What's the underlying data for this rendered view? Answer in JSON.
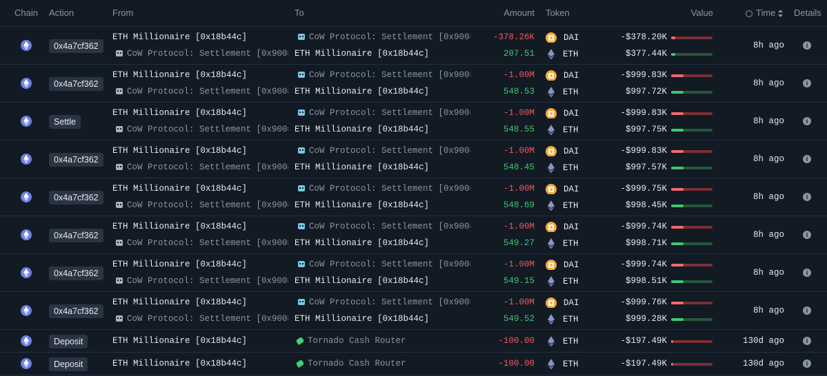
{
  "header": {
    "chain": "Chain",
    "action": "Action",
    "from": "From",
    "to": "To",
    "amount": "Amount",
    "token": "Token",
    "value": "Value",
    "time": "Time",
    "details": "Details"
  },
  "colors": {
    "negative": "#ef5a5a",
    "positive": "#3fc66f",
    "dai": "#f5ac37",
    "eth_chain": "#6f7fe6"
  },
  "rows": [
    {
      "action": "0x4a7cf362",
      "time": "8h ago",
      "from1": "ETH Millionaire [0x18b44c]",
      "to1": "CoW Protocol: Settlement [0x9008…",
      "amount1": "-378.26K",
      "token1": "DAI",
      "value1": "-$378.20K",
      "level1": 0.1,
      "from2": "CoW Protocol: Settlement [0x9008…",
      "to2": "ETH Millionaire [0x18b44c]",
      "amount2": "207.51",
      "token2": "ETH",
      "value2": "$377.44K",
      "level2": 0.1
    },
    {
      "action": "0x4a7cf362",
      "time": "8h ago",
      "from1": "ETH Millionaire [0x18b44c]",
      "to1": "CoW Protocol: Settlement [0x9008…",
      "amount1": "-1.00M",
      "token1": "DAI",
      "value1": "-$999.83K",
      "level1": 0.3,
      "from2": "CoW Protocol: Settlement [0x9008…",
      "to2": "ETH Millionaire [0x18b44c]",
      "amount2": "548.53",
      "token2": "ETH",
      "value2": "$997.72K",
      "level2": 0.3
    },
    {
      "action": "Settle",
      "time": "8h ago",
      "from1": "ETH Millionaire [0x18b44c]",
      "to1": "CoW Protocol: Settlement [0x9008…",
      "amount1": "-1.00M",
      "token1": "DAI",
      "value1": "-$999.83K",
      "level1": 0.3,
      "from2": "CoW Protocol: Settlement [0x9008…",
      "to2": "ETH Millionaire [0x18b44c]",
      "amount2": "548.55",
      "token2": "ETH",
      "value2": "$997.75K",
      "level2": 0.3
    },
    {
      "action": "0x4a7cf362",
      "time": "8h ago",
      "from1": "ETH Millionaire [0x18b44c]",
      "to1": "CoW Protocol: Settlement [0x9008…",
      "amount1": "-1.00M",
      "token1": "DAI",
      "value1": "-$999.83K",
      "level1": 0.3,
      "from2": "CoW Protocol: Settlement [0x9008…",
      "to2": "ETH Millionaire [0x18b44c]",
      "amount2": "548.45",
      "token2": "ETH",
      "value2": "$997.57K",
      "level2": 0.3
    },
    {
      "action": "0x4a7cf362",
      "time": "8h ago",
      "from1": "ETH Millionaire [0x18b44c]",
      "to1": "CoW Protocol: Settlement [0x9008…",
      "amount1": "-1.00M",
      "token1": "DAI",
      "value1": "-$999.75K",
      "level1": 0.3,
      "from2": "CoW Protocol: Settlement [0x9008…",
      "to2": "ETH Millionaire [0x18b44c]",
      "amount2": "548.69",
      "token2": "ETH",
      "value2": "$998.45K",
      "level2": 0.3
    },
    {
      "action": "0x4a7cf362",
      "time": "8h ago",
      "from1": "ETH Millionaire [0x18b44c]",
      "to1": "CoW Protocol: Settlement [0x9008…",
      "amount1": "-1.00M",
      "token1": "DAI",
      "value1": "-$999.74K",
      "level1": 0.3,
      "from2": "CoW Protocol: Settlement [0x9008…",
      "to2": "ETH Millionaire [0x18b44c]",
      "amount2": "549.27",
      "token2": "ETH",
      "value2": "$998.71K",
      "level2": 0.3
    },
    {
      "action": "0x4a7cf362",
      "time": "8h ago",
      "from1": "ETH Millionaire [0x18b44c]",
      "to1": "CoW Protocol: Settlement [0x9008…",
      "amount1": "-1.00M",
      "token1": "DAI",
      "value1": "-$999.74K",
      "level1": 0.3,
      "from2": "CoW Protocol: Settlement [0x9008…",
      "to2": "ETH Millionaire [0x18b44c]",
      "amount2": "549.15",
      "token2": "ETH",
      "value2": "$998.51K",
      "level2": 0.3
    },
    {
      "action": "0x4a7cf362",
      "time": "8h ago",
      "from1": "ETH Millionaire [0x18b44c]",
      "to1": "CoW Protocol: Settlement [0x9008…",
      "amount1": "-1.00M",
      "token1": "DAI",
      "value1": "-$999.76K",
      "level1": 0.3,
      "from2": "CoW Protocol: Settlement [0x9008…",
      "to2": "ETH Millionaire [0x18b44c]",
      "amount2": "549.52",
      "token2": "ETH",
      "value2": "$999.28K",
      "level2": 0.3
    }
  ],
  "deposits": [
    {
      "action": "Deposit",
      "from": "ETH Millionaire [0x18b44c]",
      "to": "Tornado Cash Router",
      "amount": "-100.00",
      "token": "ETH",
      "value": "-$197.49K",
      "level": 0.05,
      "time": "130d ago"
    },
    {
      "action": "Deposit",
      "from": "ETH Millionaire [0x18b44c]",
      "to": "Tornado Cash Router",
      "amount": "-100.00",
      "token": "ETH",
      "value": "-$197.49K",
      "level": 0.05,
      "time": "130d ago"
    }
  ]
}
